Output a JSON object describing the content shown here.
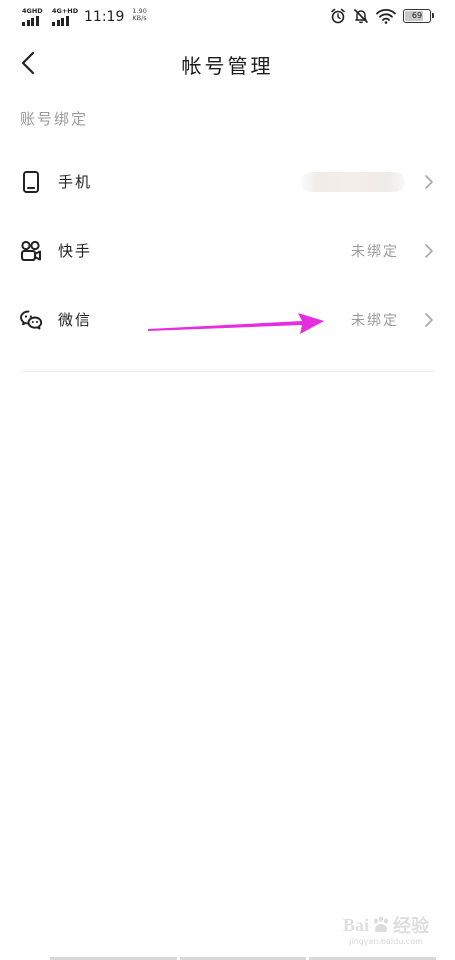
{
  "status_bar": {
    "network1": "4GHD",
    "network2": "4G+HD",
    "time": "11:19",
    "speed_value": "1.90",
    "speed_unit": "KB/s",
    "battery": "69"
  },
  "header": {
    "title": "帐号管理"
  },
  "section": {
    "label": "账号绑定"
  },
  "rows": [
    {
      "label": "手机",
      "status": ""
    },
    {
      "label": "快手",
      "status": "未绑定"
    },
    {
      "label": "微信",
      "status": "未绑定"
    }
  ],
  "annotation": {
    "arrow_color": "#e62ee0"
  },
  "watermark": {
    "logo_left": "Bai",
    "logo_right": "经验",
    "url": "jingyan.baidu.com"
  }
}
